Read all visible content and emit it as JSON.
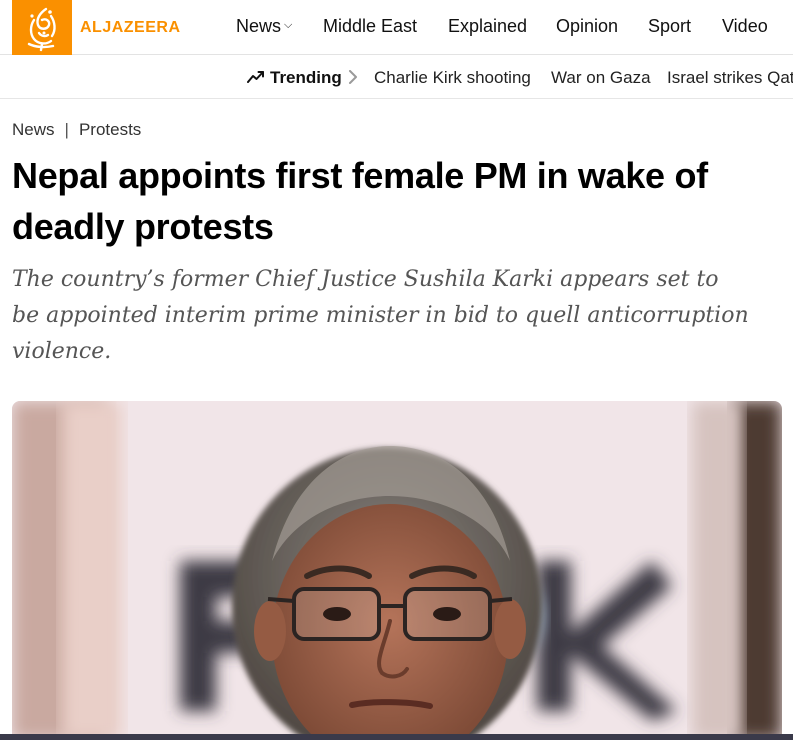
{
  "brand": {
    "name": "ALJAZEERA",
    "accent_color": "#fa9000",
    "logo_icon": "aljazeera-calligraphy-logo"
  },
  "nav": {
    "items": [
      {
        "label": "News",
        "has_dropdown": true
      },
      {
        "label": "Middle East"
      },
      {
        "label": "Explained"
      },
      {
        "label": "Opinion"
      },
      {
        "label": "Sport"
      },
      {
        "label": "Video"
      }
    ]
  },
  "trending": {
    "icon": "trending-up-icon",
    "label": "Trending",
    "chevron_icon": "chevron-right-icon",
    "topics": [
      "Charlie Kirk shooting",
      "War on Gaza",
      "Israel strikes Qatar"
    ]
  },
  "breadcrumb": {
    "items": [
      "News",
      "Protests"
    ],
    "separator": "|"
  },
  "article": {
    "headline": "Nepal appoints first female PM in wake of deadly protests",
    "dek": "The country’s former Chief Justice Sushila Karki appears set to be appointed interim prime minister in bid to quell anticorruption violence.",
    "hero_image": "portrait-photo-sushila-karki"
  }
}
